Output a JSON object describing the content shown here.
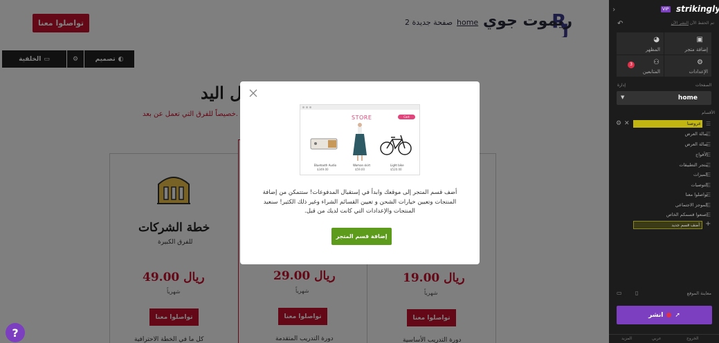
{
  "site": {
    "brand": "ريموت جوي",
    "nav": {
      "home": "home",
      "page": "صفحة جديدة 2",
      "cta": "تواصلوا معنا"
    },
    "edit_bar": {
      "design": "تصميم",
      "background": "الخلفية"
    },
    "hero": {
      "title": "ل اليد!",
      "subtitle": "خصيصاً للفرق التي تعمل عن بعد."
    },
    "plans": [
      {
        "name": "خطة الشركات",
        "for": "للفرق الكبيرة",
        "price": "49.00 ريال",
        "period": "شهرياً",
        "cta": "تواصلوا معنا",
        "foot": "كل ما في الخطة الاحترافية"
      },
      {
        "name": "",
        "for": "",
        "price": "29.00 ريال",
        "period": "شهرياً",
        "cta": "تواصلوا معنا",
        "foot": "دورة التدريب المتقدمة"
      },
      {
        "name": "",
        "for": "",
        "price": "19.00 ريال",
        "period": "شهرياً",
        "cta": "تواصلوا معنا",
        "foot": "دورة التدريب الأساسية"
      }
    ]
  },
  "modal": {
    "store_title": "STORE",
    "store_pill": "Cart",
    "products": [
      {
        "name": "Bluetooth Audio",
        "price": "$349.00"
      },
      {
        "name": "Woman skirt",
        "price": "$59.00"
      },
      {
        "name": "Light bike",
        "price": "$520.00"
      }
    ],
    "text": "أضف قسم المتجر إلى موقعك وابدأ في إستقبال المدفوعات! ستتمكن من إضافة المنتجات وتعيين خيارات الشحن و تعيين القسائم الشراء وغير ذلك الكثير! سنعيد المنتجات والإعدادات التي كانت لديك من قبل.",
    "button": "إضافة قسم المتجر"
  },
  "help": "?",
  "sidebar": {
    "vip": "VIP",
    "brand": "strikingly",
    "save_text": "تم الحفظ الآن",
    "publish_link": "النشر الآن",
    "tools": [
      {
        "label": "المظهر",
        "icon": "palette-icon"
      },
      {
        "label": "إضافة متجر",
        "icon": "store-icon"
      },
      {
        "label": "المتابعين",
        "icon": "users-icon",
        "badge": "3"
      },
      {
        "label": "الإعدادات",
        "icon": "gear-icon"
      }
    ],
    "pages_header": "الصفحات",
    "manage": "إدارة",
    "page_select": "home",
    "sections_header": "الأقسام",
    "sections": [
      "عروضنا",
      "صالة العرض",
      "صالة العرض",
      "الأفواج",
      "متجر التطبيقات",
      "الميزات",
      "التوصيات",
      "تواصلوا معنا",
      "الموجز الاجتماعي",
      "اصنعوا قسمكم الخاص"
    ],
    "add_section": "أضف قسم جديد",
    "preview": "معاينة الموقع",
    "publish": "انشر",
    "footer": [
      "المزيد",
      "عربي",
      "الخروج"
    ]
  },
  "colors": {
    "accent": "#c8102e",
    "publish": "#7b3fbf",
    "store_button": "#5d9b1d",
    "highlight": "#c2b712"
  }
}
